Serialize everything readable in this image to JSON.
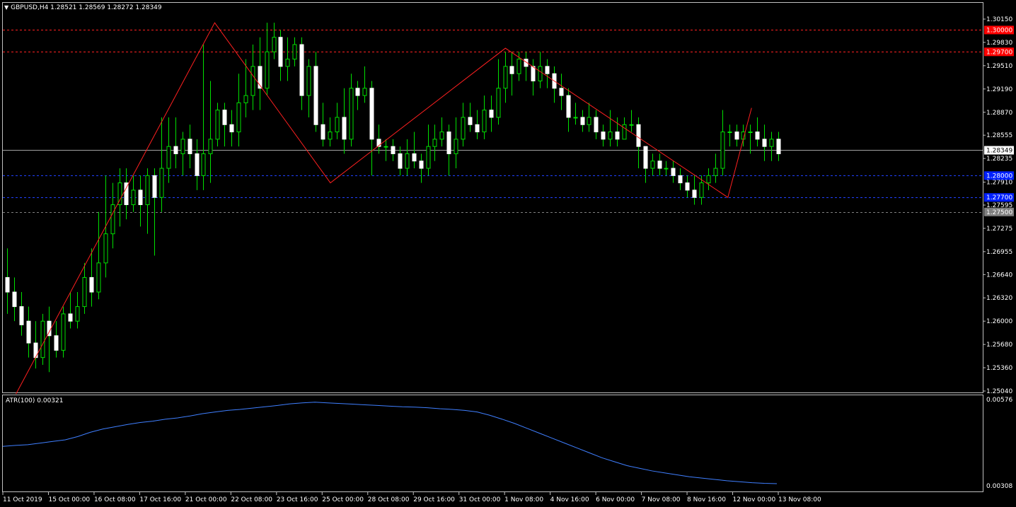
{
  "header": {
    "symbol_line": "GBPUSD,H4  1.28521 1.28569 1.28272 1.28349"
  },
  "indicator": {
    "label": "ATR(100) 0.00321",
    "scale_labels": [
      "0.00576",
      "0.00308"
    ],
    "color": "#3f7fff"
  },
  "chart_data": {
    "type": "candlestick",
    "symbol": "GBPUSD",
    "timeframe": "H4",
    "ohlc": {
      "open": 1.28521,
      "high": 1.28569,
      "low": 1.28272,
      "close": 1.28349
    },
    "ylim": [
      1.2504,
      1.3015
    ],
    "price_ticks": [
      "1.30150",
      "1.29830",
      "1.29510",
      "1.29190",
      "1.28870",
      "1.28555",
      "1.28235",
      "1.27910",
      "1.27595",
      "1.27275",
      "1.26955",
      "1.26640",
      "1.26320",
      "1.26000",
      "1.25680",
      "1.25360",
      "1.25040"
    ],
    "time_ticks": [
      "11 Oct 2019",
      "15 Oct 00:00",
      "16 Oct 08:00",
      "17 Oct 16:00",
      "21 Oct 00:00",
      "22 Oct 08:00",
      "23 Oct 16:00",
      "25 Oct 00:00",
      "28 Oct 08:00",
      "29 Oct 16:00",
      "31 Oct 00:00",
      "1 Nov 08:00",
      "4 Nov 16:00",
      "6 Nov 00:00",
      "7 Nov 08:00",
      "8 Nov 16:00",
      "12 Nov 00:00",
      "13 Nov 08:00"
    ],
    "current_price": {
      "value": 1.28349,
      "label": "1.28349"
    },
    "horizontal_lines": [
      {
        "value": 1.3,
        "label": "1.30000",
        "color": "#ff2020",
        "label_bg": "#ff0000"
      },
      {
        "value": 1.297,
        "label": "1.29700",
        "color": "#ff2020",
        "label_bg": "#ff0000"
      },
      {
        "value": 1.28,
        "label": "1.28000",
        "color": "#2040ff",
        "label_bg": "#0020ff"
      },
      {
        "value": 1.277,
        "label": "1.27700",
        "color": "#2040ff",
        "label_bg": "#0020ff"
      },
      {
        "value": 1.275,
        "label": "1.27500",
        "color": "#808080",
        "label_bg": "#808080"
      }
    ],
    "zigzag": [
      {
        "bar": 3,
        "value": 1.25
      },
      {
        "bar": 70,
        "value": 1.301
      },
      {
        "bar": 109,
        "value": 1.279
      },
      {
        "bar": 168,
        "value": 1.2975
      },
      {
        "bar": 243,
        "value": 1.277
      },
      {
        "bar": 251,
        "value": 1.2893
      }
    ],
    "candles": [
      [
        1.266,
        1.264,
        1.27,
        1.261
      ],
      [
        1.264,
        1.262,
        1.266,
        1.26
      ],
      [
        1.262,
        1.2595,
        1.264,
        1.258
      ],
      [
        1.26,
        1.257,
        1.262,
        1.255
      ],
      [
        1.257,
        1.255,
        1.26,
        1.2535
      ],
      [
        1.255,
        1.26,
        1.261,
        1.254
      ],
      [
        1.26,
        1.258,
        1.262,
        1.253
      ],
      [
        1.258,
        1.256,
        1.26,
        1.255
      ],
      [
        1.256,
        1.261,
        1.262,
        1.255
      ],
      [
        1.261,
        1.26,
        1.264,
        1.259
      ],
      [
        1.26,
        1.262,
        1.264,
        1.259
      ],
      [
        1.262,
        1.266,
        1.268,
        1.261
      ],
      [
        1.266,
        1.264,
        1.27,
        1.262
      ],
      [
        1.264,
        1.268,
        1.275,
        1.263
      ],
      [
        1.268,
        1.272,
        1.28,
        1.266
      ],
      [
        1.272,
        1.276,
        1.279,
        1.27
      ],
      [
        1.276,
        1.279,
        1.281,
        1.273
      ],
      [
        1.279,
        1.276,
        1.281,
        1.274
      ],
      [
        1.276,
        1.278,
        1.28,
        1.275
      ],
      [
        1.278,
        1.276,
        1.28,
        1.273
      ],
      [
        1.276,
        1.28,
        1.281,
        1.272
      ],
      [
        1.28,
        1.277,
        1.281,
        1.269
      ],
      [
        1.277,
        1.281,
        1.288,
        1.275
      ],
      [
        1.281,
        1.284,
        1.288,
        1.279
      ],
      [
        1.284,
        1.283,
        1.288,
        1.281
      ],
      [
        1.283,
        1.285,
        1.286,
        1.28
      ],
      [
        1.285,
        1.283,
        1.287,
        1.281
      ],
      [
        1.283,
        1.28,
        1.285,
        1.278
      ],
      [
        1.28,
        1.283,
        1.298,
        1.278
      ],
      [
        1.283,
        1.285,
        1.293,
        1.279
      ],
      [
        1.285,
        1.289,
        1.29,
        1.284
      ],
      [
        1.289,
        1.287,
        1.29,
        1.284
      ],
      [
        1.287,
        1.286,
        1.289,
        1.284
      ],
      [
        1.286,
        1.29,
        1.294,
        1.284
      ],
      [
        1.29,
        1.291,
        1.296,
        1.288
      ],
      [
        1.291,
        1.295,
        1.298,
        1.289
      ],
      [
        1.295,
        1.292,
        1.299,
        1.289
      ],
      [
        1.292,
        1.297,
        1.301,
        1.291
      ],
      [
        1.297,
        1.299,
        1.301,
        1.296
      ],
      [
        1.299,
        1.295,
        1.3,
        1.293
      ],
      [
        1.295,
        1.296,
        1.299,
        1.293
      ],
      [
        1.296,
        1.298,
        1.299,
        1.295
      ],
      [
        1.298,
        1.291,
        1.299,
        1.289
      ],
      [
        1.291,
        1.295,
        1.296,
        1.288
      ],
      [
        1.295,
        1.287,
        1.297,
        1.286
      ],
      [
        1.287,
        1.285,
        1.29,
        1.284
      ],
      [
        1.285,
        1.286,
        1.288,
        1.284
      ],
      [
        1.286,
        1.288,
        1.29,
        1.285
      ],
      [
        1.288,
        1.285,
        1.292,
        1.283
      ],
      [
        1.285,
        1.292,
        1.294,
        1.284
      ],
      [
        1.292,
        1.291,
        1.293,
        1.289
      ],
      [
        1.291,
        1.292,
        1.295,
        1.29
      ],
      [
        1.292,
        1.285,
        1.293,
        1.28
      ],
      [
        1.285,
        1.284,
        1.287,
        1.283
      ],
      [
        1.284,
        1.284,
        1.285,
        1.282
      ],
      [
        1.284,
        1.283,
        1.285,
        1.282
      ],
      [
        1.283,
        1.281,
        1.284,
        1.28
      ],
      [
        1.281,
        1.283,
        1.285,
        1.28
      ],
      [
        1.283,
        1.282,
        1.286,
        1.281
      ],
      [
        1.282,
        1.281,
        1.283,
        1.279
      ],
      [
        1.281,
        1.284,
        1.287,
        1.28
      ],
      [
        1.284,
        1.285,
        1.287,
        1.282
      ],
      [
        1.285,
        1.286,
        1.288,
        1.284
      ],
      [
        1.286,
        1.283,
        1.287,
        1.28
      ],
      [
        1.283,
        1.285,
        1.288,
        1.281
      ],
      [
        1.285,
        1.288,
        1.29,
        1.284
      ],
      [
        1.288,
        1.287,
        1.29,
        1.286
      ],
      [
        1.287,
        1.286,
        1.289,
        1.285
      ],
      [
        1.286,
        1.289,
        1.291,
        1.285
      ],
      [
        1.289,
        1.288,
        1.291,
        1.286
      ],
      [
        1.288,
        1.292,
        1.296,
        1.287
      ],
      [
        1.292,
        1.295,
        1.297,
        1.29
      ],
      [
        1.295,
        1.294,
        1.297,
        1.291
      ],
      [
        1.294,
        1.296,
        1.297,
        1.293
      ],
      [
        1.296,
        1.295,
        1.297,
        1.293
      ],
      [
        1.295,
        1.293,
        1.296,
        1.291
      ],
      [
        1.293,
        1.295,
        1.297,
        1.292
      ],
      [
        1.295,
        1.294,
        1.296,
        1.292
      ],
      [
        1.294,
        1.292,
        1.295,
        1.29
      ],
      [
        1.292,
        1.291,
        1.294,
        1.289
      ],
      [
        1.291,
        1.288,
        1.292,
        1.286
      ],
      [
        1.288,
        1.288,
        1.29,
        1.287
      ],
      [
        1.288,
        1.287,
        1.289,
        1.286
      ],
      [
        1.287,
        1.288,
        1.29,
        1.286
      ],
      [
        1.288,
        1.286,
        1.289,
        1.285
      ],
      [
        1.286,
        1.285,
        1.287,
        1.284
      ],
      [
        1.285,
        1.286,
        1.289,
        1.284
      ],
      [
        1.286,
        1.285,
        1.288,
        1.284
      ],
      [
        1.285,
        1.287,
        1.288,
        1.285
      ],
      [
        1.287,
        1.287,
        1.289,
        1.286
      ],
      [
        1.287,
        1.284,
        1.288,
        1.281
      ],
      [
        1.284,
        1.281,
        1.284,
        1.279
      ],
      [
        1.281,
        1.282,
        1.283,
        1.28
      ],
      [
        1.282,
        1.281,
        1.283,
        1.28
      ],
      [
        1.281,
        1.281,
        1.282,
        1.28
      ],
      [
        1.281,
        1.28,
        1.282,
        1.279
      ],
      [
        1.28,
        1.279,
        1.281,
        1.278
      ],
      [
        1.279,
        1.278,
        1.28,
        1.277
      ],
      [
        1.278,
        1.277,
        1.28,
        1.276
      ],
      [
        1.277,
        1.279,
        1.28,
        1.276
      ],
      [
        1.279,
        1.28,
        1.281,
        1.278
      ],
      [
        1.28,
        1.281,
        1.283,
        1.279
      ],
      [
        1.281,
        1.286,
        1.289,
        1.28
      ],
      [
        1.286,
        1.286,
        1.287,
        1.284
      ],
      [
        1.286,
        1.285,
        1.287,
        1.284
      ],
      [
        1.285,
        1.286,
        1.287,
        1.284
      ],
      [
        1.286,
        1.286,
        1.287,
        1.283
      ],
      [
        1.286,
        1.285,
        1.288,
        1.284
      ],
      [
        1.285,
        1.284,
        1.287,
        1.282
      ],
      [
        1.284,
        1.285,
        1.286,
        1.282
      ],
      [
        1.285,
        1.283,
        1.286,
        1.282
      ]
    ],
    "atr": [
      0.00435,
      0.00438,
      0.0044,
      0.00445,
      0.0045,
      0.00455,
      0.00465,
      0.00478,
      0.00488,
      0.00495,
      0.00502,
      0.00508,
      0.00512,
      0.00518,
      0.00522,
      0.00528,
      0.00535,
      0.0054,
      0.00545,
      0.00548,
      0.00552,
      0.00556,
      0.0056,
      0.00565,
      0.00568,
      0.0057,
      0.00568,
      0.00566,
      0.00564,
      0.00562,
      0.0056,
      0.00558,
      0.00556,
      0.00555,
      0.00553,
      0.0055,
      0.00548,
      0.00545,
      0.0054,
      0.0053,
      0.00518,
      0.00505,
      0.0049,
      0.00475,
      0.0046,
      0.00445,
      0.0043,
      0.00415,
      0.004,
      0.00388,
      0.00376,
      0.00368,
      0.0036,
      0.00354,
      0.00348,
      0.00342,
      0.00338,
      0.00334,
      0.0033,
      0.00327,
      0.00324,
      0.00322,
      0.00321
    ]
  }
}
